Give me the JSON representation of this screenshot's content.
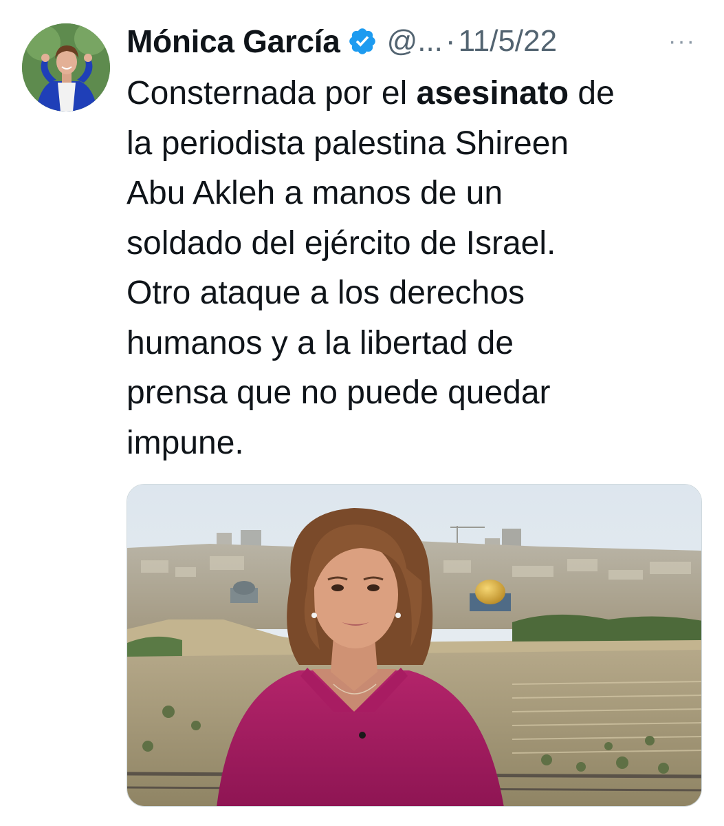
{
  "tweet": {
    "author": {
      "display_name": "Mónica García",
      "handle": "@...",
      "verified": true,
      "avatar_icon": "profile-photo"
    },
    "separator": "·",
    "date": "11/5/22",
    "more_label": "···",
    "text": {
      "line1_pre": "Consternada por el ",
      "line1_bold": "asesinato",
      "line1_post": " de",
      "line2": "la periodista palestina Shireen",
      "line3": "Abu Akleh a manos de un",
      "line4": "soldado del ejército de Israel.",
      "line5": "Otro ataque a los derechos",
      "line6": "humanos y a la libertad de",
      "line7": "prensa que no puede quedar",
      "line8": "impune."
    },
    "media": {
      "type": "photo",
      "icon": "attached-photo"
    },
    "colors": {
      "verified_blue": "#1d9bf0",
      "secondary_text": "#536471",
      "primary_text": "#0f1419"
    }
  }
}
